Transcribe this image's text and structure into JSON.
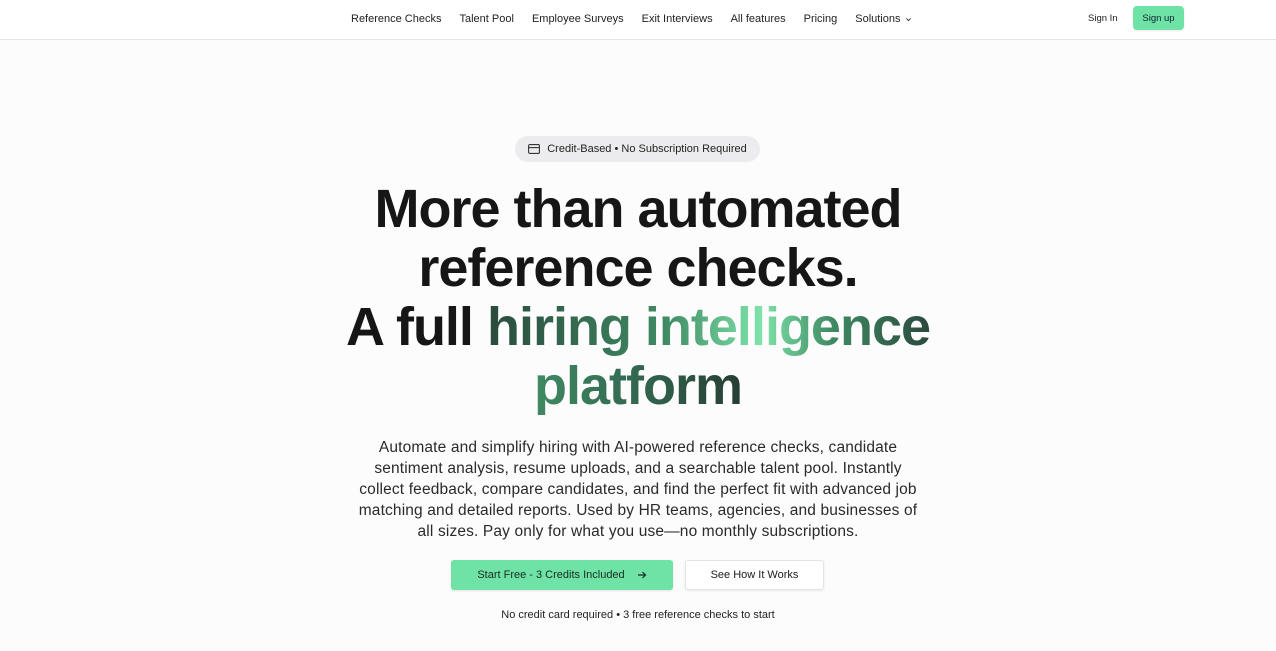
{
  "nav": {
    "links": [
      "Reference Checks",
      "Talent Pool",
      "Employee Surveys",
      "Exit Interviews",
      "All features",
      "Pricing"
    ],
    "solutions_label": "Solutions",
    "sign_in": "Sign In",
    "sign_up": "Sign up"
  },
  "badge": {
    "icon": "credit-card-icon",
    "text": "Credit-Based • No Subscription Required"
  },
  "hero": {
    "line1": "More than automated",
    "line2": "reference checks.",
    "line3_plain": "A full ",
    "line3_highlight": "hiring intelligence",
    "line4_highlight": "platform",
    "description": "Automate and simplify hiring with AI-powered reference checks, candidate sentiment analysis, resume uploads, and a searchable talent pool. Instantly collect feedback, compare candidates, and find the perfect fit with advanced job matching and detailed reports. Used by HR teams, agencies, and businesses of all sizes. Pay only for what you use—no monthly subscriptions."
  },
  "cta": {
    "primary": "Start Free - 3 Credits Included",
    "secondary": "See How It Works",
    "note": "No credit card required • 3 free reference checks to start"
  },
  "colors": {
    "accent": "#6fe3a6",
    "gradient_dark": "#2b4a3c",
    "gradient_mid": "#3f8a63",
    "gradient_light": "#7fe3aa"
  }
}
